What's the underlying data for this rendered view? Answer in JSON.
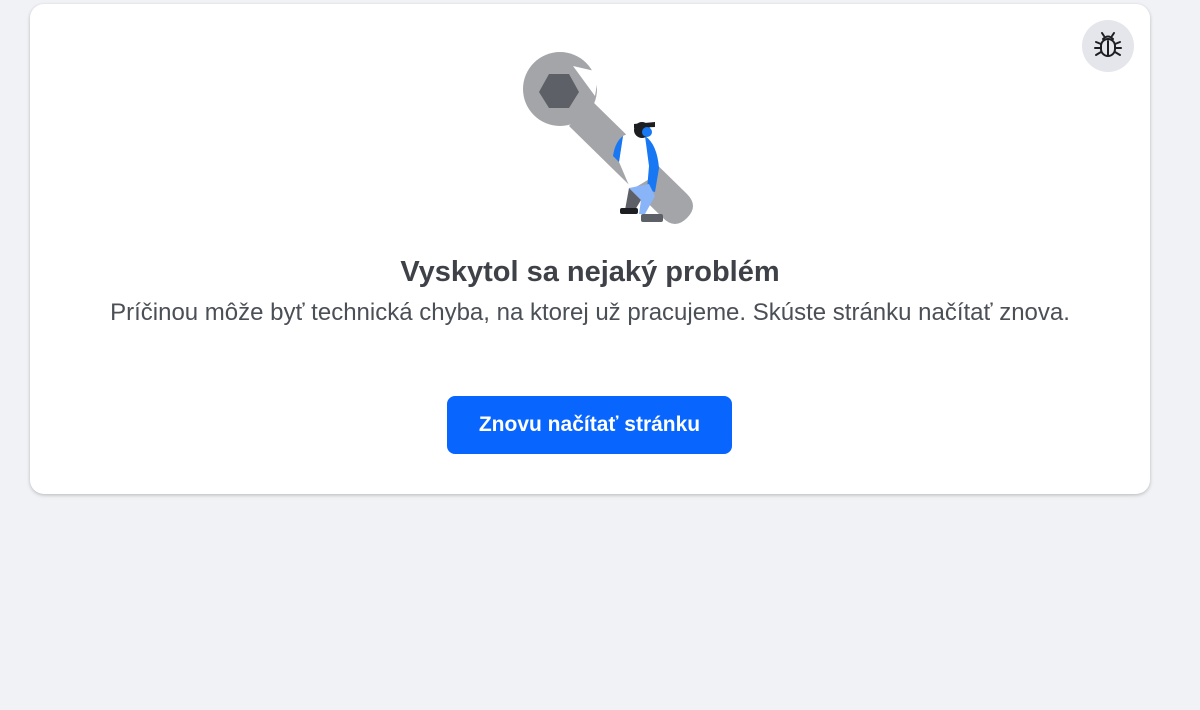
{
  "error_card": {
    "title": "Vyskytol sa nejaký problém",
    "message": "Príčinou môže byť technická chyba, na ktorej už pracujeme. Skúste stránku načítať znova.",
    "reload_label": "Znovu načítať stránku",
    "bug_icon": "bug-icon",
    "illustration_icon": "wrench-worker-illustration"
  },
  "colors": {
    "background": "#f0f2f5",
    "card": "#ffffff",
    "primary_button": "#0866ff",
    "title_text": "#3e4147",
    "body_text": "#4b4f56"
  }
}
